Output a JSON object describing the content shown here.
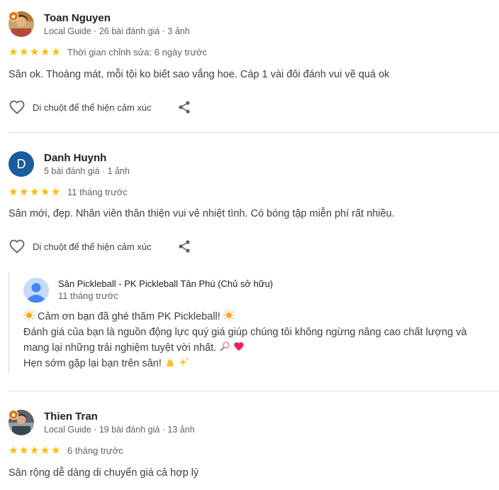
{
  "reviews": [
    {
      "name": "Toan Nguyen",
      "meta": "Local Guide · 26 bài đánh giá · 3 ảnh",
      "stars": 5,
      "time": "Thời gian chỉnh sửa: 6 ngày trước",
      "text": "Sân ok. Thoáng mát, mỗi tội ko biết sao vắng hoe. Cáp 1 vài đôi đánh vui vẽ quá ok",
      "like_label": "Di chuột để thể hiện cảm xúc"
    },
    {
      "name": "Danh Huynh",
      "avatar_letter": "D",
      "meta": "5 bài đánh giá · 1 ảnh",
      "stars": 5,
      "time": "11 tháng trước",
      "text": "Sân mới, đẹp. Nhân viên thân thiện vui vẻ nhiệt tình. Có bóng tập miễn phí rất nhiều.",
      "like_label": "Di chuột để thể hiện cảm xúc"
    },
    {
      "name": "Thien Tran",
      "meta": "Local Guide · 19 bài đánh giá · 13 ảnh",
      "stars": 5,
      "time": "6 tháng trước",
      "text": "Sân rộng dễ dàng di chuyển giá cả hợp lý"
    }
  ],
  "owner_reply": {
    "name": "Sân Pickleball - PK Pickleball Tân Phú (Chủ sở hữu)",
    "time": "11 tháng trước",
    "line1": "Cảm ơn bạn đã ghé thăm PK Pickleball!",
    "line2": "Đánh giá của bạn là nguồn động lực quý giá giúp chúng tôi không ngừng nâng cao chất lượng và",
    "line3": "mang lại những trải nghiệm tuyệt vời nhất.",
    "line4": "Hẹn sớm gặp lại bạn trên sân!"
  },
  "colors": {
    "star": "#fbbc04",
    "avatar_d": "#1a5c9e",
    "guide_badge": "#e8710a",
    "divider": "#dadce0"
  },
  "icons": [
    "heart-outline-icon",
    "share-icon",
    "star-icon",
    "local-guide-badge-icon",
    "sun-emoji",
    "heart-emoji",
    "pray-emoji",
    "sparkles-emoji",
    "badminton-emoji"
  ]
}
